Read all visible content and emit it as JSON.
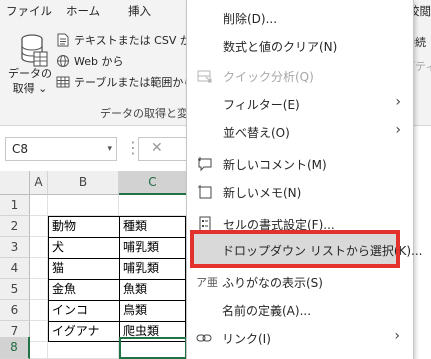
{
  "ribbon": {
    "tabs": [
      "ファイル",
      "ホーム",
      "挿入",
      "校閲"
    ],
    "get_data_label_line1": "データの",
    "get_data_label_line2": "取得 ⌄",
    "buttons": [
      "テキストまたは CSV から",
      "Web から",
      "テーブルまたは範囲から"
    ],
    "group_label": "データの取得と変",
    "right_fragments": [
      "接続",
      "パティ"
    ]
  },
  "formula_bar": {
    "name_box": "C8",
    "name_box_arrow": "▾",
    "separator": "⋮",
    "cancel_icon": "✕"
  },
  "grid": {
    "columns": [
      "A",
      "B",
      "C"
    ],
    "rows": [
      "1",
      "2",
      "3",
      "4",
      "5",
      "6",
      "7",
      "8"
    ],
    "cells": [
      [
        "",
        "",
        ""
      ],
      [
        "",
        "",
        ""
      ],
      [
        "",
        "動物",
        "種類"
      ],
      [
        "",
        "犬",
        "哺乳類"
      ],
      [
        "",
        "猫",
        "哺乳類"
      ],
      [
        "",
        "金魚",
        "魚類"
      ],
      [
        "",
        "インコ",
        "鳥類"
      ],
      [
        "",
        "イグアナ",
        "爬虫類"
      ]
    ],
    "selected_cell": "C8"
  },
  "context_menu": {
    "items": [
      {
        "label": "削除(D)...",
        "icon": "none"
      },
      {
        "label": "数式と値のクリア(N)",
        "icon": "none"
      },
      {
        "label": "クイック分析(Q)",
        "icon": "quick-analysis-icon",
        "disabled": true
      },
      {
        "label": "フィルター(E)",
        "icon": "none",
        "submenu": true
      },
      {
        "label": "並べ替え(O)",
        "icon": "none",
        "submenu": true
      },
      {
        "label": "新しいコメント(M)",
        "icon": "new-comment-icon"
      },
      {
        "label": "新しいメモ(N)",
        "icon": "new-note-icon"
      },
      {
        "label": "セルの書式設定(F)...",
        "icon": "format-cells-icon"
      },
      {
        "label": "ドロップダウン リストから選択(K)...",
        "icon": "none",
        "highlighted": true
      },
      {
        "label": "ふりがなの表示(S)",
        "icon": "furigana-icon",
        "icon_text": "ア亜"
      },
      {
        "label": "名前の定義(A)...",
        "icon": "none"
      },
      {
        "label": "リンク(I)",
        "icon": "link-icon",
        "submenu": true
      }
    ],
    "submenu_arrow": "›"
  },
  "colors": {
    "excel_green": "#217346",
    "highlight_red": "#e3322b",
    "disabled_text": "#a6a6a6"
  }
}
